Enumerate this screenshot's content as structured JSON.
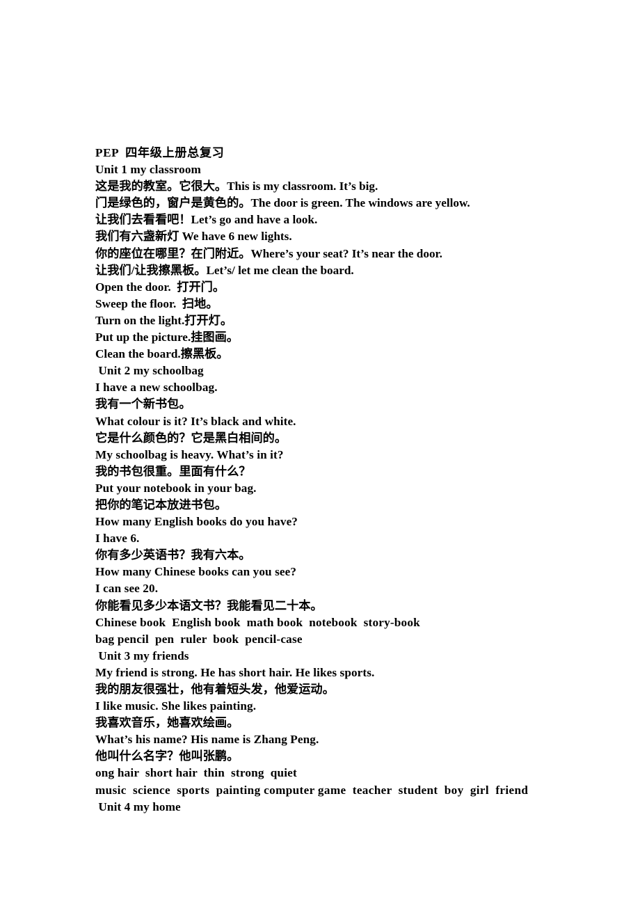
{
  "document": {
    "title": "PEP 四年级上册总复习",
    "page_background": "#ffffff",
    "text_color": "#000000",
    "lines": [
      {
        "id": "l1",
        "text": "PEP  四年级上册总复习",
        "kind": "header"
      },
      {
        "id": "l2",
        "text": "Unit 1 my classroom",
        "kind": "unit-heading"
      },
      {
        "id": "l3",
        "text": "这是我的教室。它很大。This is my classroom. It’s big.",
        "kind": "bilingual"
      },
      {
        "id": "l4",
        "text": "门是绿色的，窗户是黄色的。The door is green. The windows are yellow.",
        "kind": "bilingual"
      },
      {
        "id": "l5",
        "text": "让我们去看看吧！Let’s go and have a look.",
        "kind": "bilingual"
      },
      {
        "id": "l6",
        "text": "我们有六盏新灯 We have 6 new lights.",
        "kind": "bilingual"
      },
      {
        "id": "l7",
        "text": "你的座位在哪里？在门附近。Where’s your seat? It’s near the door.",
        "kind": "bilingual"
      },
      {
        "id": "l8",
        "text": "让我们/让我擦黑板。Let’s/ let me clean the board.",
        "kind": "bilingual"
      },
      {
        "id": "l9",
        "text": "Open the door.  打开门。",
        "kind": "bilingual"
      },
      {
        "id": "l10",
        "text": "Sweep the floor.  扫地。",
        "kind": "bilingual"
      },
      {
        "id": "l11",
        "text": "Turn on the light.打开灯。",
        "kind": "bilingual"
      },
      {
        "id": "l12",
        "text": "Put up the picture.挂图画。",
        "kind": "bilingual"
      },
      {
        "id": "l13",
        "text": "Clean the board.擦黑板。",
        "kind": "bilingual"
      },
      {
        "id": "l14",
        "text": " Unit 2 my schoolbag",
        "kind": "unit-heading"
      },
      {
        "id": "l15",
        "text": "I have a new schoolbag.",
        "kind": "english"
      },
      {
        "id": "l16",
        "text": "我有一个新书包。",
        "kind": "chinese"
      },
      {
        "id": "l17",
        "text": "What colour is it? It’s black and white.",
        "kind": "english"
      },
      {
        "id": "l18",
        "text": "它是什么颜色的？它是黑白相间的。",
        "kind": "chinese"
      },
      {
        "id": "l19",
        "text": "My schoolbag is heavy. What’s in it?",
        "kind": "english"
      },
      {
        "id": "l20",
        "text": "我的书包很重。里面有什么？",
        "kind": "chinese"
      },
      {
        "id": "l21",
        "text": "Put your notebook in your bag.",
        "kind": "english"
      },
      {
        "id": "l22",
        "text": "把你的笔记本放进书包。",
        "kind": "chinese"
      },
      {
        "id": "l23",
        "text": "How many English books do you have?",
        "kind": "english"
      },
      {
        "id": "l24",
        "text": "I have 6.",
        "kind": "english"
      },
      {
        "id": "l25",
        "text": "你有多少英语书？我有六本。",
        "kind": "chinese"
      },
      {
        "id": "l26",
        "text": "How many Chinese books can you see?",
        "kind": "english"
      },
      {
        "id": "l27",
        "text": "I can see 20.",
        "kind": "english"
      },
      {
        "id": "l28",
        "text": "你能看见多少本语文书？我能看见二十本。",
        "kind": "chinese"
      },
      {
        "id": "l29",
        "text": "Chinese book  English book  math book  notebook  story-book",
        "kind": "vocab"
      },
      {
        "id": "l30",
        "text": "bag pencil  pen  ruler  book  pencil-case",
        "kind": "vocab"
      },
      {
        "id": "l31",
        "text": " Unit 3 my friends",
        "kind": "unit-heading"
      },
      {
        "id": "l32",
        "text": "My friend is strong. He has short hair. He likes sports.",
        "kind": "english"
      },
      {
        "id": "l33",
        "text": "我的朋友很强壮，他有着短头发，他爱运动。",
        "kind": "chinese"
      },
      {
        "id": "l34",
        "text": "I like music. She likes painting.",
        "kind": "english"
      },
      {
        "id": "l35",
        "text": "我喜欢音乐，她喜欢绘画。",
        "kind": "chinese"
      },
      {
        "id": "l36",
        "text": "What’s his name? His name is Zhang Peng.",
        "kind": "english"
      },
      {
        "id": "l37",
        "text": "他叫什么名字？他叫张鹏。",
        "kind": "chinese"
      },
      {
        "id": "l38",
        "text": "ong hair  short hair  thin  strong  quiet",
        "kind": "vocab"
      },
      {
        "id": "l39",
        "text": "music  science  sports  painting computer game  teacher  student  boy  girl  friend",
        "kind": "vocab-wide"
      },
      {
        "id": "l40",
        "text": " Unit 4 my home",
        "kind": "unit-heading"
      }
    ]
  }
}
